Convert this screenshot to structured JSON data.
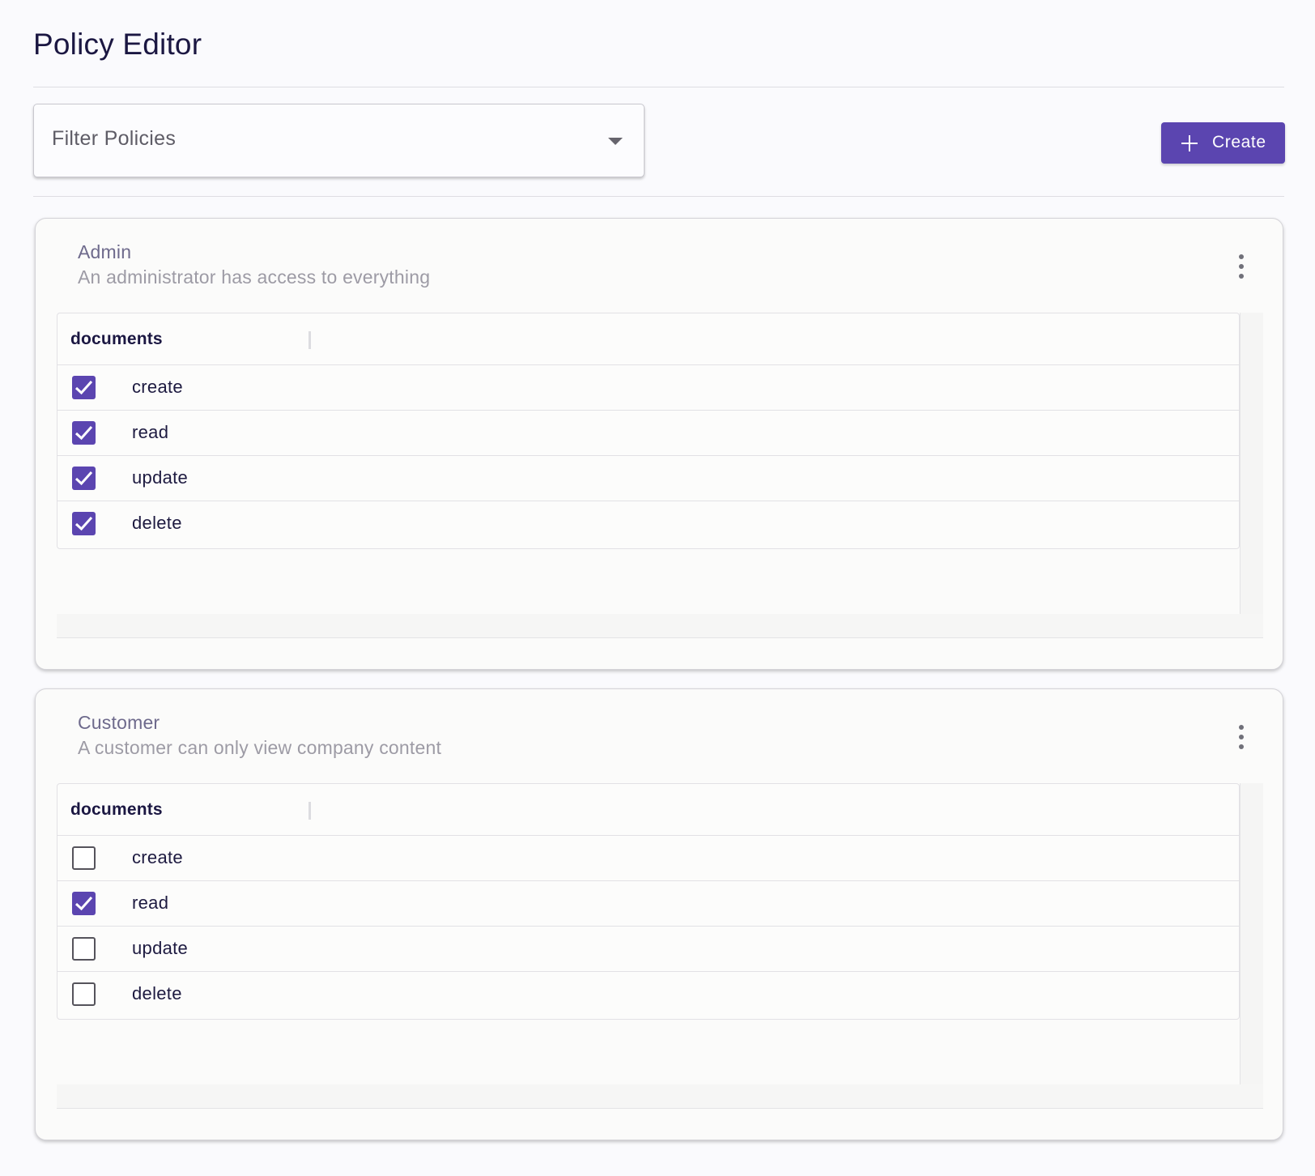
{
  "header": {
    "title": "Policy Editor"
  },
  "toolbar": {
    "filter_placeholder": "Filter Policies",
    "filter_icon": "chevron-down-icon",
    "create_label": "Create",
    "create_icon": "plus-icon"
  },
  "colors": {
    "accent": "#5b45b0",
    "page_background": "#fafafd",
    "title_text": "#1b1742",
    "muted_text": "#9d9ba5"
  },
  "policies": [
    {
      "name": "Admin",
      "description": "An administrator has access to everything",
      "menu_icon": "more-vertical-icon",
      "resource": "documents",
      "permissions": [
        {
          "label": "create",
          "checked": true
        },
        {
          "label": "read",
          "checked": true
        },
        {
          "label": "update",
          "checked": true
        },
        {
          "label": "delete",
          "checked": true
        }
      ]
    },
    {
      "name": "Customer",
      "description": "A customer can only view company content",
      "menu_icon": "more-vertical-icon",
      "resource": "documents",
      "permissions": [
        {
          "label": "create",
          "checked": false
        },
        {
          "label": "read",
          "checked": true
        },
        {
          "label": "update",
          "checked": false
        },
        {
          "label": "delete",
          "checked": false
        }
      ]
    }
  ]
}
